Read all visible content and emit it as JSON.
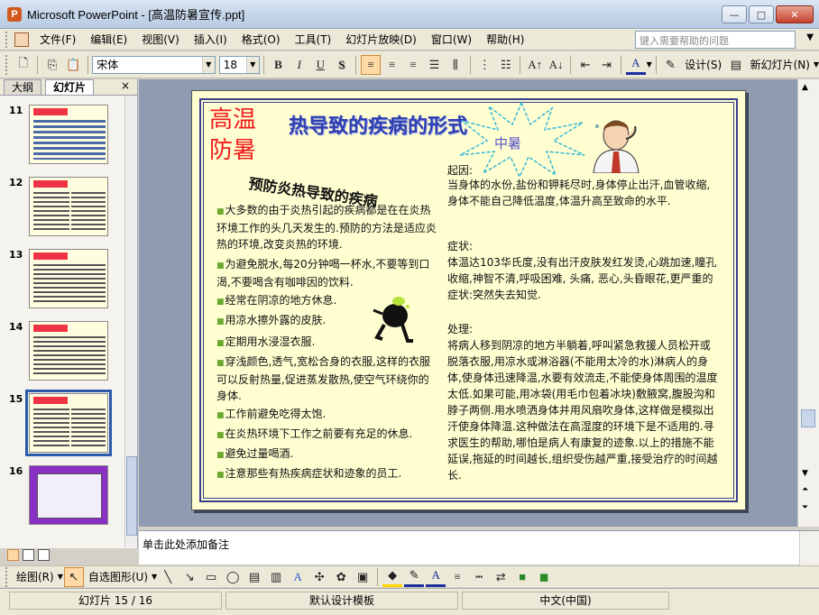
{
  "window": {
    "title": "Microsoft PowerPoint - [高温防暑宣传.ppt]",
    "app_icon": "P",
    "minimize": "—",
    "maximize": "□",
    "close": "✕"
  },
  "menubar": {
    "items": [
      "文件(F)",
      "编辑(E)",
      "视图(V)",
      "插入(I)",
      "格式(O)",
      "工具(T)",
      "幻灯片放映(D)",
      "窗口(W)",
      "帮助(H)"
    ],
    "help_placeholder": "键入需要帮助的问题"
  },
  "toolbar": {
    "font_name": "宋体",
    "font_size": "18",
    "bold": "B",
    "italic": "I",
    "underline": "U",
    "shadow": "S",
    "design_label": "设计(S)",
    "new_slide_label": "新幻灯片(N)"
  },
  "leftpane": {
    "tab_outline": "大纲",
    "tab_slides": "幻灯片",
    "close": "×",
    "slide_numbers": [
      "11",
      "12",
      "13",
      "14",
      "15",
      "16"
    ],
    "selected": "15"
  },
  "slide": {
    "title_big": "高温防暑",
    "title_main": "热导致的疾病的形式",
    "subtitle": "预防炎热导致的疾病",
    "burst_text": "中暑",
    "bullets": [
      "大多数的由于炎热引起的疾病都是在在炎热环境工作的头几天发生的.预防的方法是适应炎热的环境,改变炎热的环境.",
      "为避免脱水,每20分钟喝一杯水,不要等到口渴,不要喝含有咖啡因的饮料.",
      "经常在阴凉的地方休息.",
      "用凉水擦外露的皮肤.",
      "定期用水浸湿衣服.",
      "穿浅颜色,透气,宽松合身的衣服,这样的衣服可以反射热量,促进蒸发散热,使空气环绕你的身体.",
      "工作前避免吃得太饱.",
      "在炎热环境下工作之前要有充足的休息.",
      "避免过量喝酒.",
      "注意那些有热疾病症状和迹象的员工."
    ],
    "cause_heading": "起因:",
    "cause_text": "当身体的水份,盐份和钾耗尽时,身体停止出汗,血管收缩,身体不能自己降低温度,体温升高至致命的水平.",
    "symptom_heading": "症状:",
    "symptom_text": "体温达103华氏度,没有出汗皮肤发红发烫,心跳加速,瞳孔收缩,神智不清,呼吸困难, 头痛, 恶心,头昏眼花,更严重的症状:突然失去知觉.",
    "treat_heading": "处理:",
    "treat_text": "将病人移到阴凉的地方半躺着,呼叫紧急救援人员松开或脱落衣服,用凉水或淋浴器(不能用太冷的水)淋病人的身体,使身体迅速降温,水要有效流走,不能使身体周围的温度太低.如果可能,用冰袋(用毛巾包着冰块)敷腋窝,腹股沟和脖子两侧.用水喷洒身体并用风扇吹身体,这样做是模拟出汗使身体降温.这种做法在高湿度的环境下是不适用的.寻求医生的帮助,哪怕是病人有康复的迹象.以上的措施不能延误,拖延的时间越长,组织受伤越严重,接受治疗的时间越长."
  },
  "notes": {
    "placeholder": "单击此处添加备注"
  },
  "drawbar": {
    "draw_label": "绘图(R)",
    "autoshape_label": "自选图形(U)"
  },
  "statusbar": {
    "slide_pos": "幻灯片 15 / 16",
    "template": "默认设计模板",
    "language": "中文(中国)"
  }
}
